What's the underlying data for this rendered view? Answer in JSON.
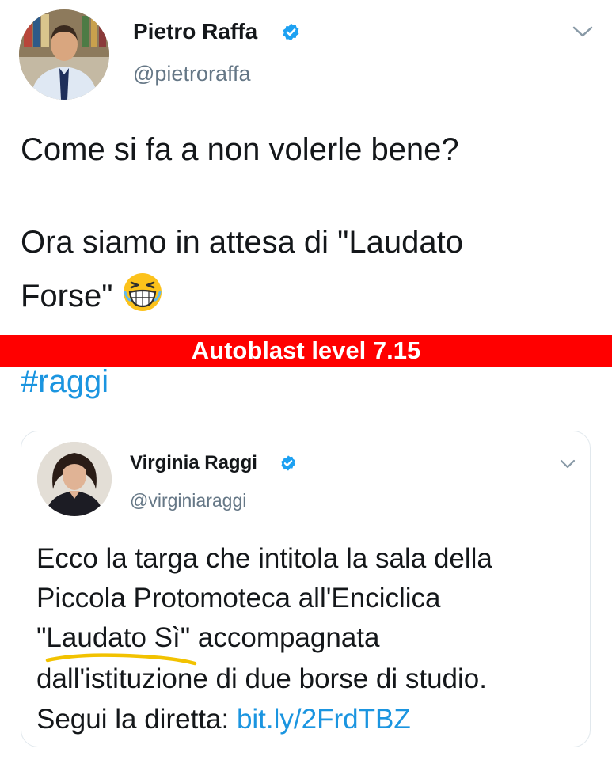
{
  "main_tweet": {
    "author_name": "Pietro Raffa",
    "author_handle": "@pietroraffa",
    "verified_icon": "verified-badge-icon",
    "menu_icon": "chevron-down-icon",
    "lines": [
      "Come si fa a non volerle bene?",
      "Ora siamo in attesa di \"Laudato",
      "Forse\""
    ],
    "emoji": "grinning-squinting-face-emoji",
    "hashtag": "#raggi"
  },
  "overlay_banner": {
    "text": "Autoblast level 7.15",
    "color": "#ff0000"
  },
  "quoted_tweet": {
    "author_name": "Virginia Raggi",
    "author_handle": "@virginiaraggi",
    "verified_icon": "verified-badge-icon",
    "menu_icon": "chevron-down-icon",
    "lines": [
      "Ecco la targa che intitola la sala della",
      "Piccola Protomoteca all'Enciclica",
      "\"Laudato Sì\" accompagnata",
      "dall'istituzione di due borse di studio.",
      "Segui la diretta: "
    ],
    "link": "bit.ly/2FrdTBZ"
  },
  "colors": {
    "text": "#14171a",
    "secondary": "#657786",
    "link": "#1b95e0",
    "verified": "#1da1f2",
    "highlight": "#f2c200"
  }
}
